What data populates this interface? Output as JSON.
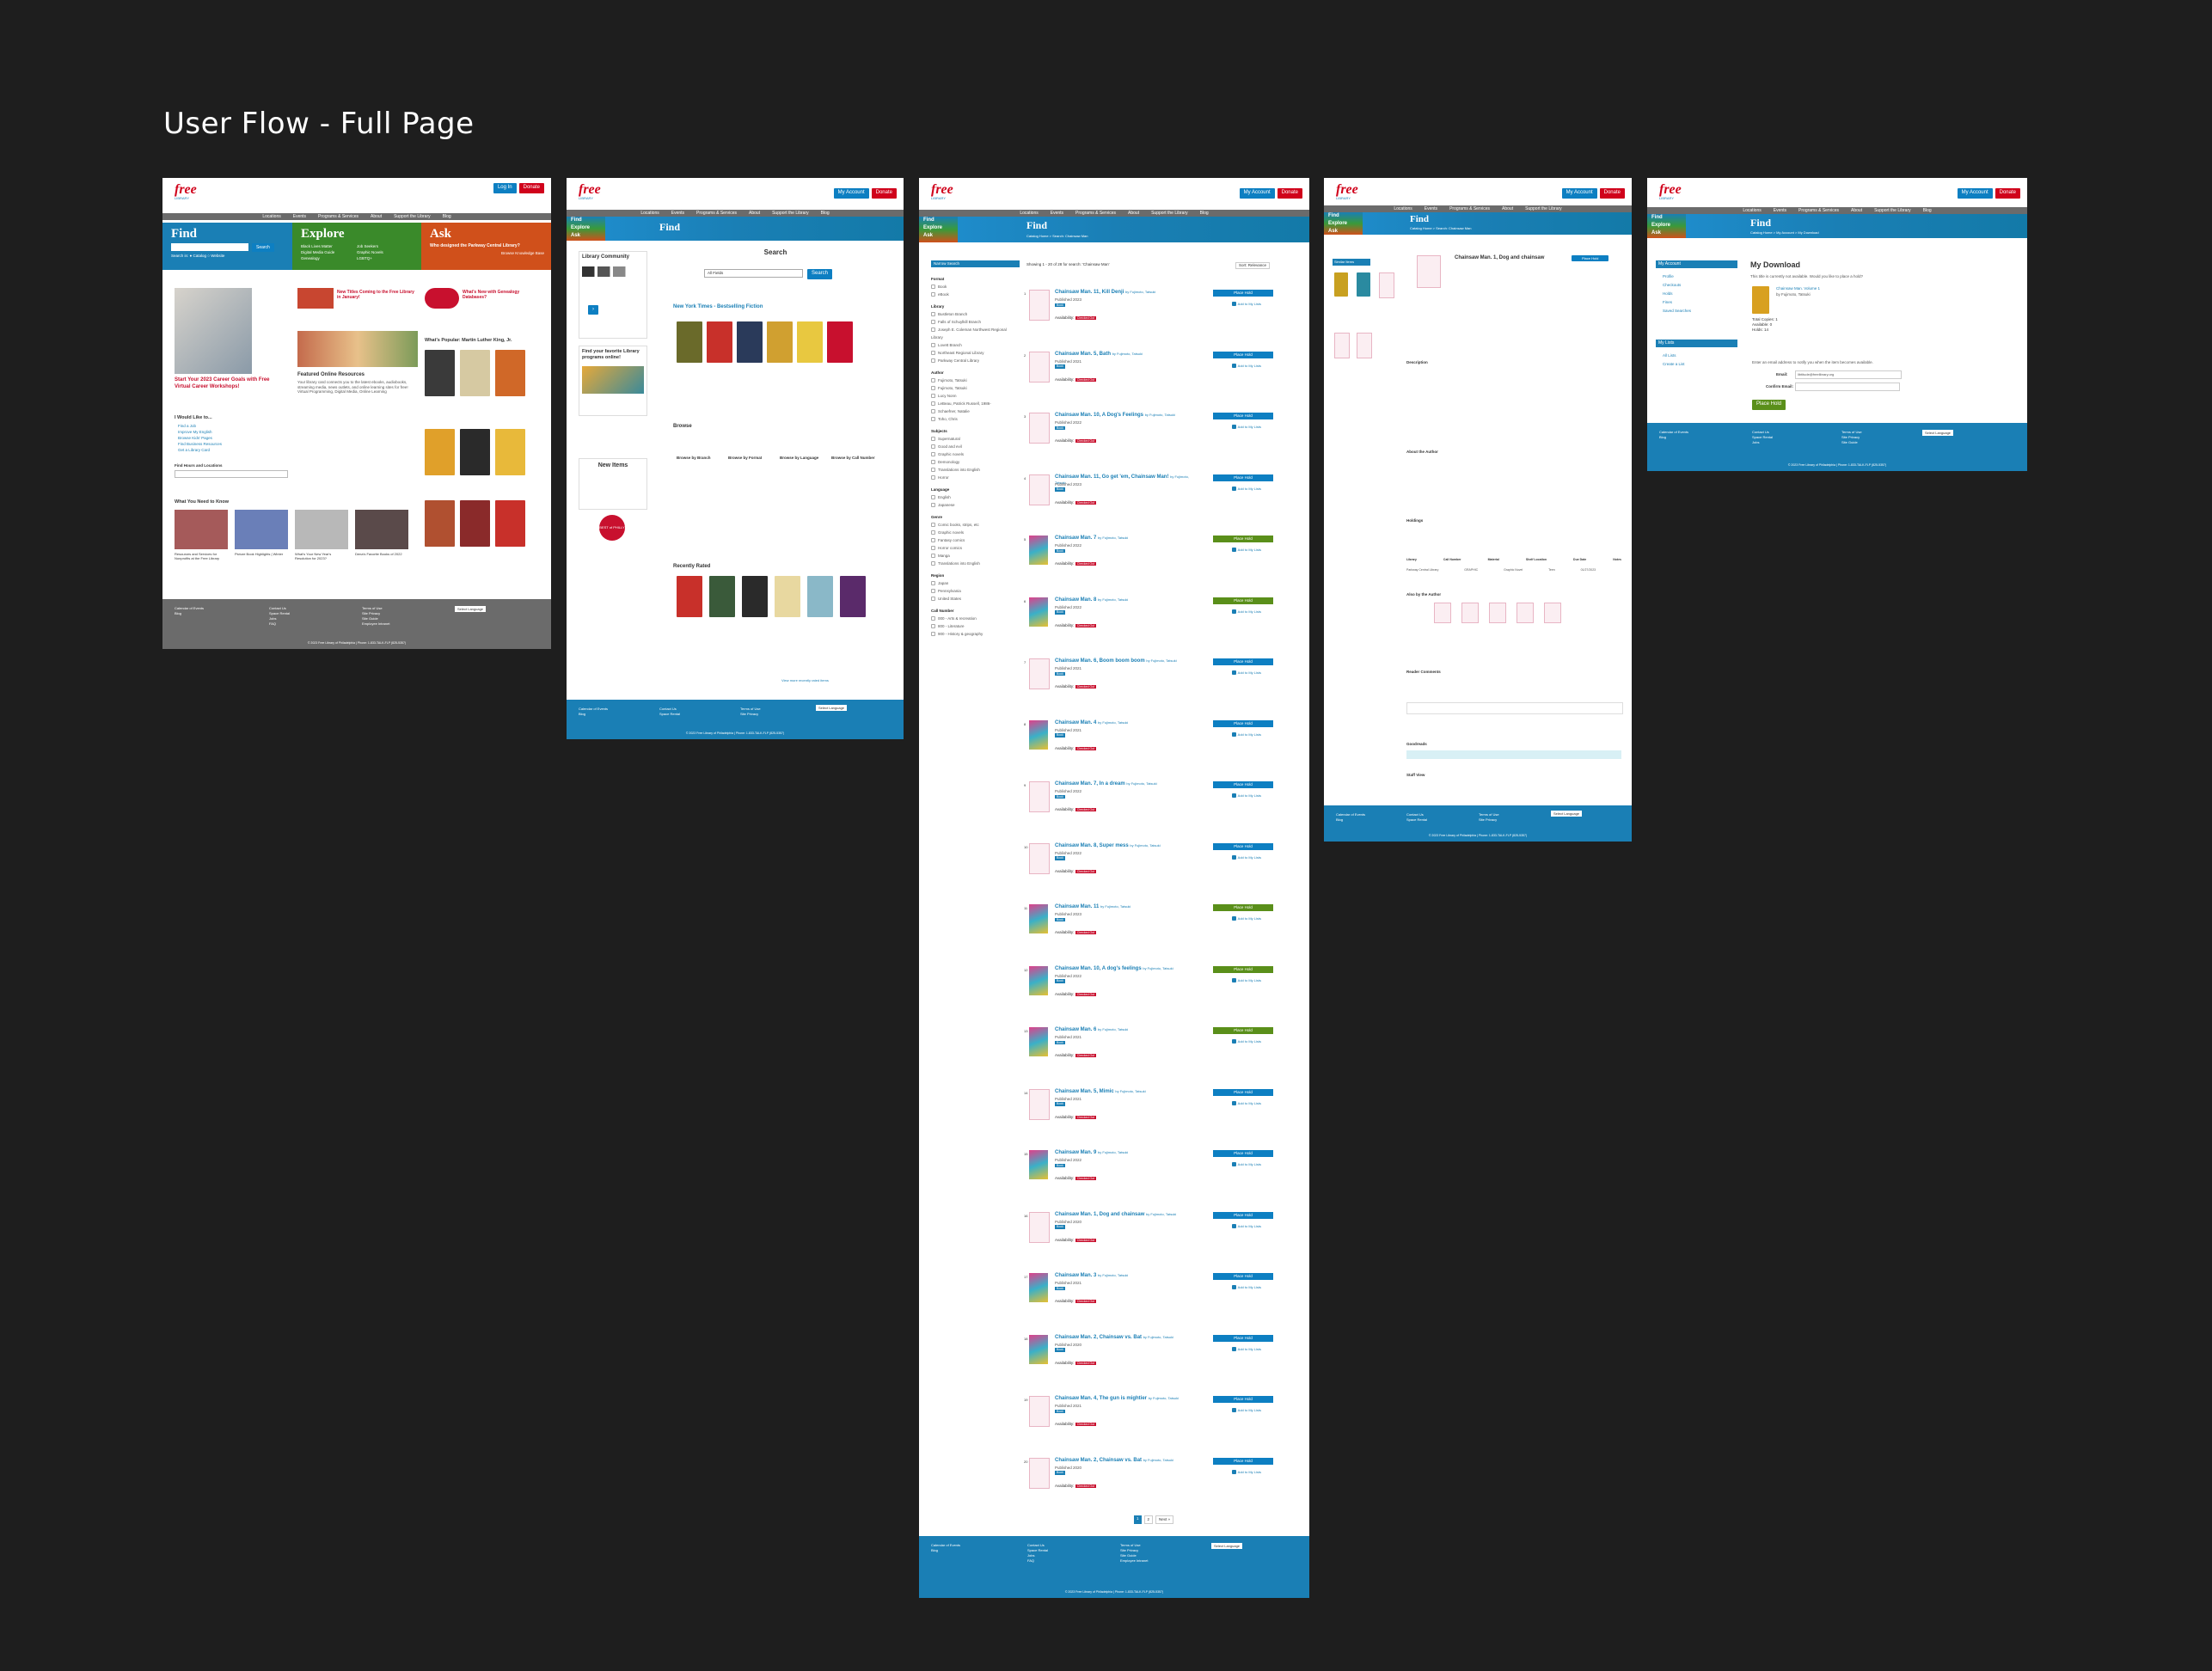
{
  "heading": "User Flow - Full Page",
  "common": {
    "logo_word": "free",
    "logo_sub": "LIBRARY",
    "login": "Log In",
    "donate": "Donate",
    "my_account": "My Account",
    "welcome": "Welcome Back!",
    "nav": [
      "Locations",
      "Events",
      "Programs & Services",
      "About",
      "Support the Library",
      "Blog"
    ],
    "find": "Find",
    "explore": "Explore",
    "ask": "Ask",
    "calendar": "Calendar of Events",
    "blog": "Blog",
    "select_language": "Select Language",
    "footer_links1": [
      "Contact Us",
      "Space Rental",
      "Jobs",
      "FAQ"
    ],
    "footer_links2": [
      "Terms of Use",
      "Site Privacy",
      "Site Guide",
      "Employee Intranet"
    ],
    "copyright": "© 2023 Free Library of Philadelphia | Phone: 1-833-TALK-FLP (825-5357)"
  },
  "home": {
    "find_search_label": "Search",
    "find_search_in": "Search in: ● Catalog ○ Website",
    "explore_items": [
      "Black Lives Matter",
      "Digital Media Guide",
      "Genealogy",
      "Job Seekers",
      "Graphic Novels",
      "LGBTQ+"
    ],
    "ask_question": "Who designed the Parkway Central Library?",
    "ask_link": "Browse Knowledge Base",
    "feature1": "Start Your 2023 Career Goals with Free Virtual Career Workshops!",
    "feature2": "New Titles Coming to the Free Library in January!",
    "feature3": "What's New with Genealogy Databases?",
    "online_resources": "Featured Online Resources",
    "online_text": "Your library card connects you to the latest ebooks, audiobooks, streaming media, news outlets, and online learning sites for free! Virtual Programming, Digital Media, Online Learning",
    "popular": "What's Popular: Martin Luther King, Jr.",
    "i_would_like": "I Would Like to...",
    "like_items": [
      "Find a Job",
      "Improve My English",
      "Browse Kids' Pages",
      "Find Business Resources",
      "Get a Library Card"
    ],
    "hours": "Find Hours and Locations",
    "need_to_know": "What You Need to Know",
    "need_items": [
      "Resources and Services for Nonprofits at the Free Library",
      "Picture Book Highlights | Winter",
      "What's Your New Year's Resolution for 2023?",
      "Dena's Favorite Books of 2022"
    ]
  },
  "find_page": {
    "community_title": "Library Community",
    "search_title": "Search",
    "all_fields": "All Fields",
    "search_btn": "Search",
    "nyt_title": "New York Times - Bestselling Fiction",
    "programs_title": "Find your favorite Library programs online!",
    "new_items": "New Items",
    "browse": "Browse",
    "browse_cols": [
      "Browse by Branch",
      "Browse by Format",
      "Browse by Language",
      "Browse by Call Number"
    ],
    "best_of": "BEST of PHILLY",
    "recently_rated": "Recently Rated",
    "view_more": "View more recently rated items"
  },
  "results": {
    "title": "Find",
    "breadcrumb": "Catalog Home > Search: Chainsaw Man",
    "showing": "Showing 1 - 20 of 28 for search: 'Chainsaw Man'",
    "narrow": "Narrow Search",
    "facets": [
      {
        "head": "Format",
        "items": [
          "Book",
          "eBook"
        ]
      },
      {
        "head": "Library",
        "items": [
          "Bustleton Branch",
          "Falls of Schuylkill Branch",
          "Joseph E. Coleman Northwest Regional Library",
          "Lovett Branch",
          "Northeast Regional Library",
          "Parkway Central Library"
        ]
      },
      {
        "head": "Author",
        "items": [
          "Fujimoto, Tatsuki",
          "Fujimoto, Tatsuki",
          "Lucy Nonn",
          "LeBeau, Patrick Russell, 1986-",
          "Schaefner, Natalie",
          "Toho, Chris"
        ]
      },
      {
        "head": "Subjects",
        "items": [
          "Supernatural",
          "Good and evil",
          "Graphic novels",
          "Demonology",
          "Translations into English",
          "Horror"
        ]
      },
      {
        "head": "Language",
        "items": [
          "English",
          "Japanese"
        ]
      },
      {
        "head": "Genre",
        "items": [
          "Comic books, strips, etc",
          "Graphic novels",
          "Fantasy comics",
          "Horror comics",
          "Manga",
          "Translations into English"
        ]
      },
      {
        "head": "Region",
        "items": [
          "Japan",
          "Pennsylvania",
          "United States"
        ]
      },
      {
        "head": "Call Number",
        "items": [
          "000 - Arts & recreation",
          "800 - Literature",
          "900 - History & geography"
        ]
      }
    ],
    "sort": "Sort: Relevance",
    "place_hold": "Place Hold",
    "add_list": "Add to My Lists",
    "book_label": "Book",
    "availability": "Availability:",
    "checked_out": "Checked Out",
    "items": [
      {
        "n": "1",
        "title": "Chainsaw Man. 11, Kill Denji",
        "by": "by Fujimoto, Tatsuki",
        "pub": "Published 2023",
        "cover": false,
        "green": false
      },
      {
        "n": "2",
        "title": "Chainsaw Man. 5, Bath",
        "by": "by Fujimoto, Tatsuki",
        "pub": "Published 2021",
        "cover": false,
        "green": false
      },
      {
        "n": "3",
        "title": "Chainsaw Man. 10, A Dog's Feelings",
        "by": "by Fujimoto, Tatsuki",
        "pub": "Published 2022",
        "cover": false,
        "green": false
      },
      {
        "n": "4",
        "title": "Chainsaw Man. 11, Go get 'em, Chainsaw Man!",
        "by": "by Fujimoto, Tatsuki",
        "pub": "Published 2023",
        "cover": false,
        "green": false
      },
      {
        "n": "5",
        "title": "Chainsaw Man. 7",
        "by": "by Fujimoto, Tatsuki",
        "pub": "Published 2022",
        "cover": true,
        "green": true
      },
      {
        "n": "6",
        "title": "Chainsaw Man. 8",
        "by": "by Fujimoto, Tatsuki",
        "pub": "Published 2022",
        "cover": true,
        "green": true
      },
      {
        "n": "7",
        "title": "Chainsaw Man. 6, Boom boom boom",
        "by": "by Fujimoto, Tatsuki",
        "pub": "Published 2021",
        "cover": false,
        "green": false
      },
      {
        "n": "8",
        "title": "Chainsaw Man. 4",
        "by": "by Fujimoto, Tatsuki",
        "pub": "Published 2021",
        "cover": true,
        "green": false
      },
      {
        "n": "9",
        "title": "Chainsaw Man. 7, In a dream",
        "by": "by Fujimoto, Tatsuki",
        "pub": "Published 2022",
        "cover": false,
        "green": false
      },
      {
        "n": "10",
        "title": "Chainsaw Man. 8, Super mess",
        "by": "by Fujimoto, Tatsuki",
        "pub": "Published 2022",
        "cover": false,
        "green": false
      },
      {
        "n": "11",
        "title": "Chainsaw Man. 11",
        "by": "by Fujimoto, Tatsuki",
        "pub": "Published 2023",
        "cover": true,
        "green": true
      },
      {
        "n": "12",
        "title": "Chainsaw Man. 10, A dog's feelings",
        "by": "by Fujimoto, Tatsuki",
        "pub": "Published 2022",
        "cover": true,
        "green": true
      },
      {
        "n": "13",
        "title": "Chainsaw Man. 6",
        "by": "by Fujimoto, Tatsuki",
        "pub": "Published 2021",
        "cover": true,
        "green": true
      },
      {
        "n": "14",
        "title": "Chainsaw Man. 5, Mimic",
        "by": "by Fujimoto, Tatsuki",
        "pub": "Published 2021",
        "cover": false,
        "green": false
      },
      {
        "n": "15",
        "title": "Chainsaw Man. 9",
        "by": "by Fujimoto, Tatsuki",
        "pub": "Published 2022",
        "cover": true,
        "green": false
      },
      {
        "n": "16",
        "title": "Chainsaw Man. 1, Dog and chainsaw",
        "by": "by Fujimoto, Tatsuki",
        "pub": "Published 2020",
        "cover": false,
        "green": false
      },
      {
        "n": "17",
        "title": "Chainsaw Man. 3",
        "by": "by Fujimoto, Tatsuki",
        "pub": "Published 2021",
        "cover": true,
        "green": false
      },
      {
        "n": "18",
        "title": "Chainsaw Man. 2, Chainsaw vs. Bat",
        "by": "by Fujimoto, Tatsuki",
        "pub": "Published 2020",
        "cover": true,
        "green": false
      },
      {
        "n": "19",
        "title": "Chainsaw Man. 4, The gun is mightier",
        "by": "by Fujimoto, Tatsuki",
        "pub": "Published 2021",
        "cover": false,
        "green": false
      },
      {
        "n": "20",
        "title": "Chainsaw Man. 2, Chainsaw vs. Bat",
        "by": "by Fujimoto, Tatsuki",
        "pub": "Published 2020",
        "cover": false,
        "green": false
      }
    ],
    "pagination": [
      "1",
      "2",
      "Next »"
    ]
  },
  "record": {
    "title": "Find",
    "breadcrumb": "Catalog Home > Search: Chainsaw Man",
    "item_title": "Chainsaw Man. 1, Dog and chainsaw",
    "similar": "Similar Items",
    "place_hold": "Place Hold",
    "description": "Description",
    "about_author": "About the Author",
    "holdings": "Holdings",
    "holdings_cols": [
      "Library",
      "Call Number",
      "Material",
      "Shelf Location",
      "Due Date",
      "Notes"
    ],
    "holding_row": [
      "Parkway Central Library",
      "GRAPHIC",
      "Graphic Novel",
      "Teen",
      "01/27/2023",
      ""
    ],
    "by_author": "Also by the Author",
    "reader_comments": "Reader Comments",
    "goodreads": "Goodreads",
    "staff_view": "Staff View"
  },
  "download": {
    "title": "Find",
    "breadcrumb": "Catalog Home > My Account > My Download",
    "heading": "My Download",
    "my_account": "My Account",
    "account_items": [
      "Profile",
      "Checkouts",
      "Holds",
      "Fines",
      "Saved Searches"
    ],
    "my_lists": "My Lists",
    "list_items": [
      "All Lists",
      "Create a List"
    ],
    "message": "This title is currently not available. Would you like to place a hold?",
    "book_title": "Chainsaw Man. Volume 1",
    "book_by": "by Fujimoto, Tatsuki",
    "total_copies": "Total Copies: 1",
    "available": "Available: 0",
    "holds": "Holds: 14",
    "email_prompt": "Enter an email address to notify you when the item becomes available.",
    "email_label": "Email:",
    "email_value": "libtitude@freelibrary.org",
    "confirm_label": "Confirm Email:",
    "place_hold": "Place Hold"
  }
}
